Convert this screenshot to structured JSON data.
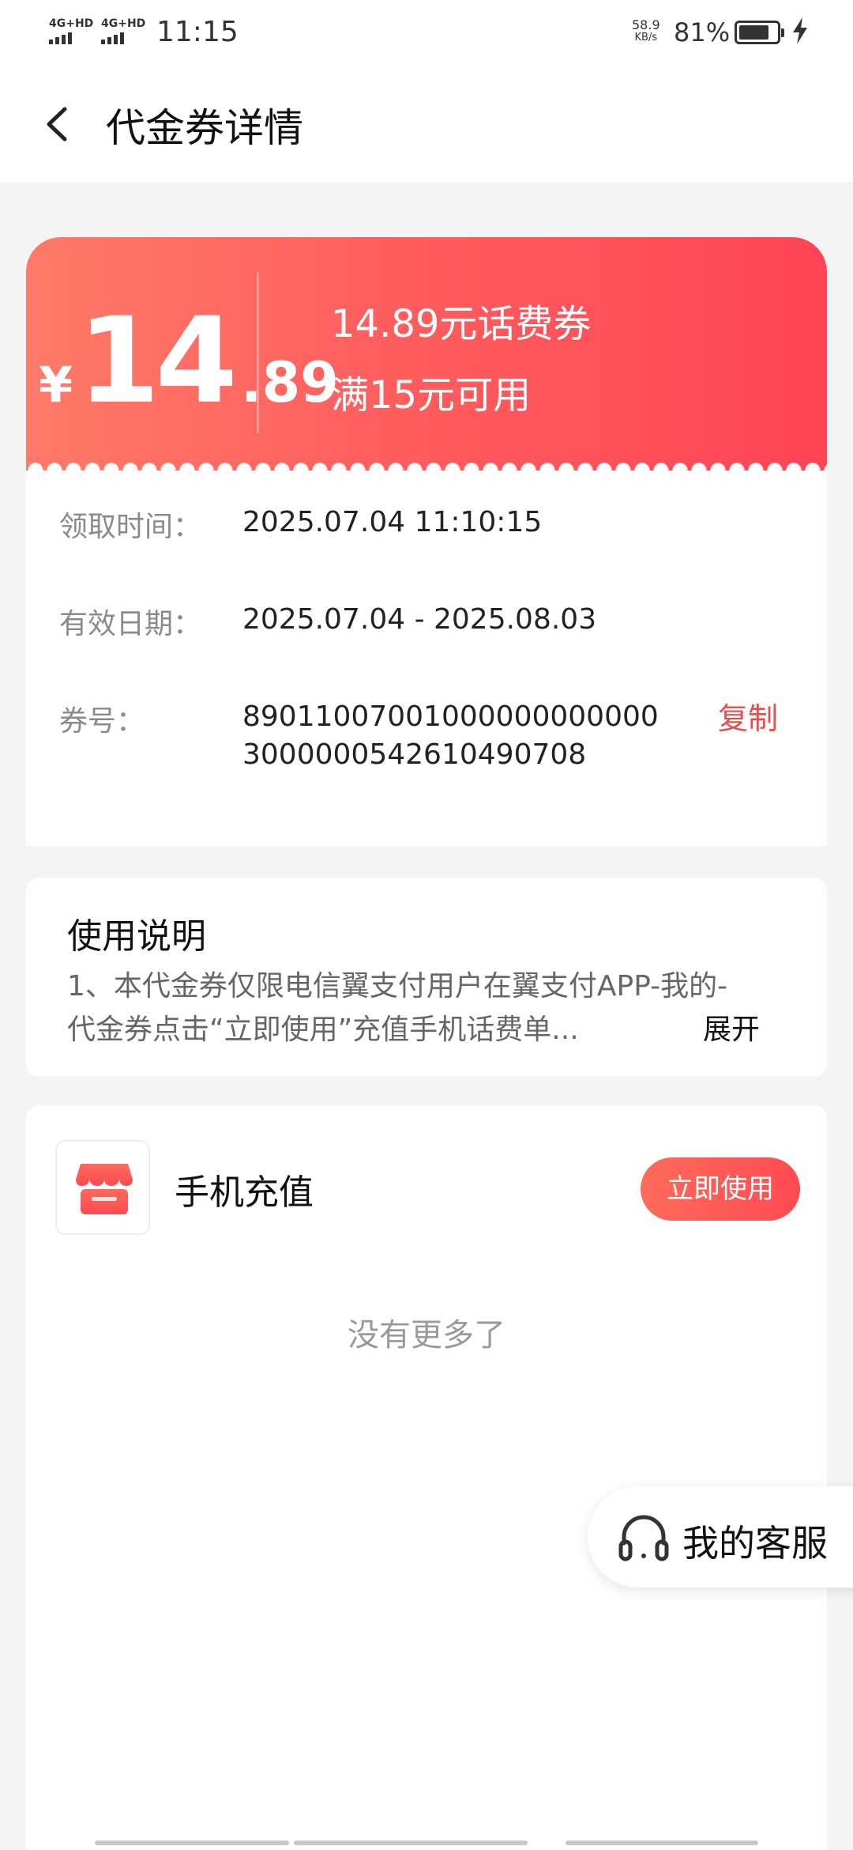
{
  "status_bar": {
    "sim1": "4G+HD",
    "sim2": "4G+HD",
    "time": "11:15",
    "net_speed_value": "58.9",
    "net_speed_unit": "KB/s",
    "battery_percent": "81%",
    "battery_level": 0.81
  },
  "header": {
    "title": "代金券详情"
  },
  "coupon": {
    "currency": "¥",
    "amount_int": "14",
    "amount_dec": ".89",
    "name": "14.89元话费券",
    "condition": "满15元可用",
    "rows": [
      {
        "label": "领取时间：",
        "value": "2025.07.04 11:10:15"
      },
      {
        "label": "有效日期：",
        "value": "2025.07.04 - 2025.08.03"
      },
      {
        "label": "券号：",
        "value": "890110070010000000000003000000542610490708"
      }
    ],
    "copy_label": "复制"
  },
  "usage": {
    "title": "使用说明",
    "text": "1、本代金券仅限电信翼支付用户在翼支付APP-我的-代金券点击“立即使用”充值手机话费单...",
    "expand_label": "展开"
  },
  "product": {
    "name": "手机充值",
    "use_label": "立即使用",
    "no_more": "没有更多了"
  },
  "customer_service": {
    "label": "我的客服"
  },
  "colors": {
    "accent": "#ff4a52",
    "coupon_gradient_start": "#ff7a68",
    "coupon_gradient_end": "#ff4455",
    "copy_red": "#e84d4d"
  },
  "icons": [
    "back-arrow-icon",
    "shop-icon",
    "headset-icon",
    "charging-bolt-icon"
  ]
}
